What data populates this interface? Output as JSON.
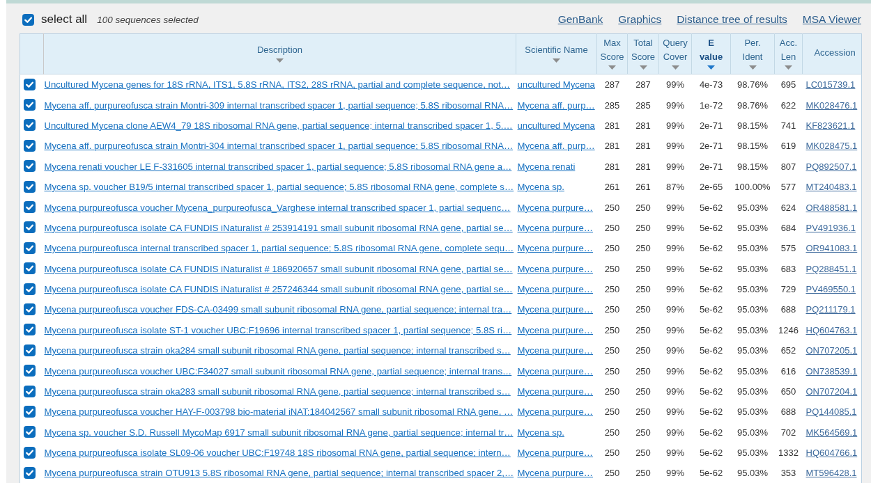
{
  "select_all": {
    "label": "select all",
    "checked": true
  },
  "selection_count": "100 sequences selected",
  "links": [
    "GenBank",
    "Graphics",
    "Distance tree of results",
    "MSA Viewer"
  ],
  "columns": [
    {
      "label": "Description",
      "sortable": true,
      "sorted": false
    },
    {
      "label": "Scientific Name",
      "sortable": true,
      "sorted": false
    },
    {
      "label": "Max Score",
      "sortable": true,
      "sorted": false
    },
    {
      "label": "Total Score",
      "sortable": true,
      "sorted": false
    },
    {
      "label": "Query Cover",
      "sortable": true,
      "sorted": false
    },
    {
      "label": "E value",
      "sortable": true,
      "sorted": true
    },
    {
      "label": "Per. Ident",
      "sortable": true,
      "sorted": false
    },
    {
      "label": "Acc. Len",
      "sortable": true,
      "sorted": false
    },
    {
      "label": "Accession",
      "sortable": false,
      "sorted": false
    }
  ],
  "rows": [
    {
      "checked": true,
      "description": "Uncultured Mycena genes for 18S rRNA, ITS1, 5.8S rRNA, ITS2, 28S rRNA, partial and complete sequence, not…",
      "scientific_name": "uncultured Mycena",
      "max_score": "287",
      "total_score": "287",
      "query_cover": "99%",
      "e_value": "4e-73",
      "per_ident": "98.76%",
      "acc_len": "695",
      "accession": "LC015739.1"
    },
    {
      "checked": true,
      "description": "Mycena aff. purpureofusca strain Montri-309 internal transcribed spacer 1, partial sequence; 5.8S ribosomal RNA…",
      "scientific_name": "Mycena aff. purp…",
      "max_score": "285",
      "total_score": "285",
      "query_cover": "99%",
      "e_value": "1e-72",
      "per_ident": "98.76%",
      "acc_len": "622",
      "accession": "MK028476.1"
    },
    {
      "checked": true,
      "description": "Uncultured Mycena clone AEW4_79 18S ribosomal RNA gene, partial sequence; internal transcribed spacer 1, 5.…",
      "scientific_name": "uncultured Mycena",
      "max_score": "281",
      "total_score": "281",
      "query_cover": "99%",
      "e_value": "2e-71",
      "per_ident": "98.15%",
      "acc_len": "741",
      "accession": "KF823621.1"
    },
    {
      "checked": true,
      "description": "Mycena aff. purpureofusca strain Montri-304 internal transcribed spacer 1, partial sequence; 5.8S ribosomal RNA…",
      "scientific_name": "Mycena aff. purp…",
      "max_score": "281",
      "total_score": "281",
      "query_cover": "99%",
      "e_value": "2e-71",
      "per_ident": "98.15%",
      "acc_len": "619",
      "accession": "MK028475.1"
    },
    {
      "checked": true,
      "description": "Mycena renati voucher LE F-331605 internal transcribed spacer 1, partial sequence; 5.8S ribosomal RNA gene a…",
      "scientific_name": "Mycena renati",
      "max_score": "281",
      "total_score": "281",
      "query_cover": "99%",
      "e_value": "2e-71",
      "per_ident": "98.15%",
      "acc_len": "807",
      "accession": "PQ892507.1"
    },
    {
      "checked": true,
      "description": "Mycena sp. voucher B19/5 internal transcribed spacer 1, partial sequence; 5.8S ribosomal RNA gene, complete s…",
      "scientific_name": "Mycena sp.",
      "max_score": "261",
      "total_score": "261",
      "query_cover": "87%",
      "e_value": "2e-65",
      "per_ident": "100.00%",
      "acc_len": "577",
      "accession": "MT240483.1"
    },
    {
      "checked": true,
      "description": "Mycena purpureofusca voucher Mycena_purpureofusca_Varghese internal transcribed spacer 1, partial sequenc…",
      "scientific_name": "Mycena purpure…",
      "max_score": "250",
      "total_score": "250",
      "query_cover": "99%",
      "e_value": "5e-62",
      "per_ident": "95.03%",
      "acc_len": "624",
      "accession": "OR488581.1"
    },
    {
      "checked": true,
      "description": "Mycena purpureofusca isolate CA FUNDIS iNaturalist # 253914191 small subunit ribosomal RNA gene, partial se…",
      "scientific_name": "Mycena purpure…",
      "max_score": "250",
      "total_score": "250",
      "query_cover": "99%",
      "e_value": "5e-62",
      "per_ident": "95.03%",
      "acc_len": "684",
      "accession": "PV491936.1"
    },
    {
      "checked": true,
      "description": "Mycena purpureofusca internal transcribed spacer 1, partial sequence; 5.8S ribosomal RNA gene, complete sequ…",
      "scientific_name": "Mycena purpure…",
      "max_score": "250",
      "total_score": "250",
      "query_cover": "99%",
      "e_value": "5e-62",
      "per_ident": "95.03%",
      "acc_len": "575",
      "accession": "OR941083.1"
    },
    {
      "checked": true,
      "description": "Mycena purpureofusca isolate CA FUNDIS iNaturalist # 186920657 small subunit ribosomal RNA gene, partial se…",
      "scientific_name": "Mycena purpure…",
      "max_score": "250",
      "total_score": "250",
      "query_cover": "99%",
      "e_value": "5e-62",
      "per_ident": "95.03%",
      "acc_len": "683",
      "accession": "PQ288451.1"
    },
    {
      "checked": true,
      "description": "Mycena purpureofusca isolate CA FUNDIS iNaturalist # 257246344 small subunit ribosomal RNA gene, partial se…",
      "scientific_name": "Mycena purpure…",
      "max_score": "250",
      "total_score": "250",
      "query_cover": "99%",
      "e_value": "5e-62",
      "per_ident": "95.03%",
      "acc_len": "729",
      "accession": "PV469550.1"
    },
    {
      "checked": true,
      "description": "Mycena purpureofusca voucher FDS-CA-03499 small subunit ribosomal RNA gene, partial sequence; internal tra…",
      "scientific_name": "Mycena purpure…",
      "max_score": "250",
      "total_score": "250",
      "query_cover": "99%",
      "e_value": "5e-62",
      "per_ident": "95.03%",
      "acc_len": "688",
      "accession": "PQ211179.1"
    },
    {
      "checked": true,
      "description": "Mycena purpureofusca isolate ST-1 voucher UBC:F19696 internal transcribed spacer 1, partial sequence; 5.8S ri…",
      "scientific_name": "Mycena purpure…",
      "max_score": "250",
      "total_score": "250",
      "query_cover": "99%",
      "e_value": "5e-62",
      "per_ident": "95.03%",
      "acc_len": "1246",
      "accession": "HQ604763.1"
    },
    {
      "checked": true,
      "description": "Mycena purpureofusca strain oka284 small subunit ribosomal RNA gene, partial sequence; internal transcribed s…",
      "scientific_name": "Mycena purpure…",
      "max_score": "250",
      "total_score": "250",
      "query_cover": "99%",
      "e_value": "5e-62",
      "per_ident": "95.03%",
      "acc_len": "652",
      "accession": "ON707205.1"
    },
    {
      "checked": true,
      "description": "Mycena purpureofusca voucher UBC:F34027 small subunit ribosomal RNA gene, partial sequence; internal trans…",
      "scientific_name": "Mycena purpure…",
      "max_score": "250",
      "total_score": "250",
      "query_cover": "99%",
      "e_value": "5e-62",
      "per_ident": "95.03%",
      "acc_len": "616",
      "accession": "ON738539.1"
    },
    {
      "checked": true,
      "description": "Mycena purpureofusca strain oka283 small subunit ribosomal RNA gene, partial sequence; internal transcribed s…",
      "scientific_name": "Mycena purpure…",
      "max_score": "250",
      "total_score": "250",
      "query_cover": "99%",
      "e_value": "5e-62",
      "per_ident": "95.03%",
      "acc_len": "650",
      "accession": "ON707204.1"
    },
    {
      "checked": true,
      "description": "Mycena purpureofusca voucher HAY-F-003798 bio-material iNAT:184042567 small subunit ribosomal RNA gene, …",
      "scientific_name": "Mycena purpure…",
      "max_score": "250",
      "total_score": "250",
      "query_cover": "99%",
      "e_value": "5e-62",
      "per_ident": "95.03%",
      "acc_len": "688",
      "accession": "PQ144085.1"
    },
    {
      "checked": true,
      "description": "Mycena sp. voucher S.D. Russell MycoMap 6917 small subunit ribosomal RNA gene, partial sequence; internal tr…",
      "scientific_name": "Mycena sp.",
      "max_score": "250",
      "total_score": "250",
      "query_cover": "99%",
      "e_value": "5e-62",
      "per_ident": "95.03%",
      "acc_len": "702",
      "accession": "MK564569.1"
    },
    {
      "checked": true,
      "description": "Mycena purpureofusca isolate SL09-06 voucher UBC:F19748 18S ribosomal RNA gene, partial sequence; intern…",
      "scientific_name": "Mycena purpure…",
      "max_score": "250",
      "total_score": "250",
      "query_cover": "99%",
      "e_value": "5e-62",
      "per_ident": "95.03%",
      "acc_len": "1332",
      "accession": "HQ604766.1"
    },
    {
      "checked": true,
      "description": "Mycena purpureofusca strain OTU913 5.8S ribosomal RNA gene, partial sequence; internal transcribed spacer 2,…",
      "scientific_name": "Mycena purpure…",
      "max_score": "250",
      "total_score": "250",
      "query_cover": "99%",
      "e_value": "5e-62",
      "per_ident": "95.03%",
      "acc_len": "353",
      "accession": "MT596428.1"
    }
  ]
}
